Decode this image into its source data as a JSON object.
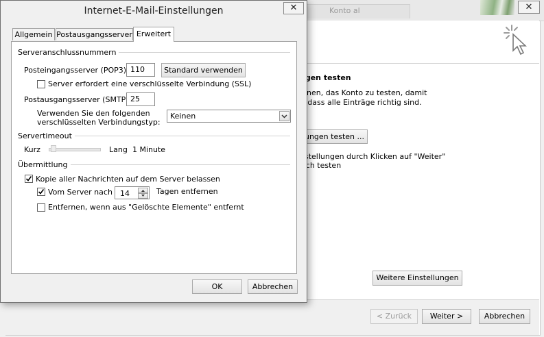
{
  "background": {
    "tab_text": "Konto al",
    "close_glyph": "✕",
    "section_title": "ngen testen",
    "desc_line1": "lhnen, das Konto zu testen, damit",
    "desc_line2": "t, dass alle Einträge richtig sind.",
    "test_button_label": "ungen testen ...",
    "next_line1": "nstellungen durch Klicken auf \"Weiter\"",
    "next_line2": "isch testen",
    "more_settings_label": "Weitere Einstellungen",
    "back_label": "< Zurück",
    "next_label": "Weiter >",
    "cancel_label": "Abbrechen",
    "cursor_icon": "pointer-cursor-sparkle-icon"
  },
  "dialog": {
    "title": "Internet-E-Mail-Einstellungen",
    "close_glyph": "✕",
    "tabs": [
      "Allgemein",
      "Postausgangsserver",
      "Erweitert"
    ],
    "active_tab": "Erweitert",
    "server_ports": {
      "group_label": "Serveranschlussnummern",
      "pop3_label": "Posteingangsserver (POP3):",
      "pop3_value": "110",
      "default_button": "Standard verwenden",
      "ssl_label": "Server erfordert eine verschlüsselte Verbindung (SSL)",
      "ssl_checked": false,
      "smtp_label": "Postausgangsserver (SMTP):",
      "smtp_value": "25",
      "encryption_label_line1": "Verwenden Sie den folgenden",
      "encryption_label_line2": "verschlüsselten Verbindungstyp:",
      "encryption_value": "Keinen"
    },
    "timeout": {
      "group_label": "Servertimeout",
      "short_label": "Kurz",
      "long_label": "Lang",
      "value": "1 Minute"
    },
    "delivery": {
      "group_label": "Übermittlung",
      "keep_copy_label": "Kopie aller Nachrichten auf dem Server belassen",
      "keep_copy_checked": true,
      "remove_after_label": "Vom Server nach",
      "remove_after_checked": true,
      "remove_after_days": "14",
      "remove_after_suffix": "Tagen entfernen",
      "remove_deleted_label": "Entfernen, wenn aus \"Gelöschte Elemente\" entfernt",
      "remove_deleted_checked": false
    },
    "ok_label": "OK",
    "cancel_label": "Abbrechen"
  }
}
